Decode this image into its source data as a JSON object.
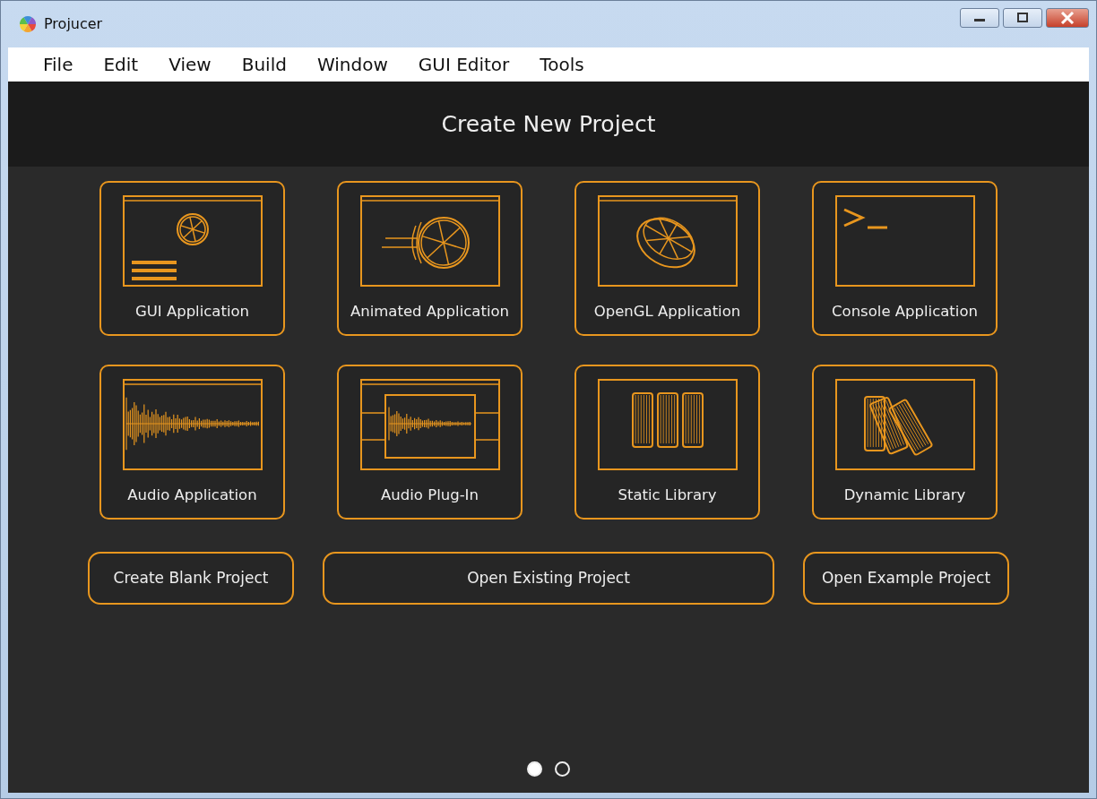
{
  "window": {
    "title": "Projucer"
  },
  "menu": [
    "File",
    "Edit",
    "View",
    "Build",
    "Window",
    "GUI Editor",
    "Tools"
  ],
  "header": {
    "title": "Create New Project"
  },
  "templates": [
    {
      "kind": "gui",
      "label": "GUI Application"
    },
    {
      "kind": "animated",
      "label": "Animated Application"
    },
    {
      "kind": "opengl",
      "label": "OpenGL Application"
    },
    {
      "kind": "console",
      "label": "Console Application"
    },
    {
      "kind": "audio",
      "label": "Audio Application"
    },
    {
      "kind": "plugin",
      "label": "Audio Plug-In"
    },
    {
      "kind": "static",
      "label": "Static Library"
    },
    {
      "kind": "dynamic",
      "label": "Dynamic Library"
    }
  ],
  "buttons": [
    {
      "label": "Create Blank Project",
      "kind": "small"
    },
    {
      "label": "Open Existing Project",
      "kind": "wide"
    },
    {
      "label": "Open Example Project",
      "kind": "small"
    }
  ],
  "pages": [
    {
      "selected": true
    },
    {
      "selected": false
    }
  ]
}
